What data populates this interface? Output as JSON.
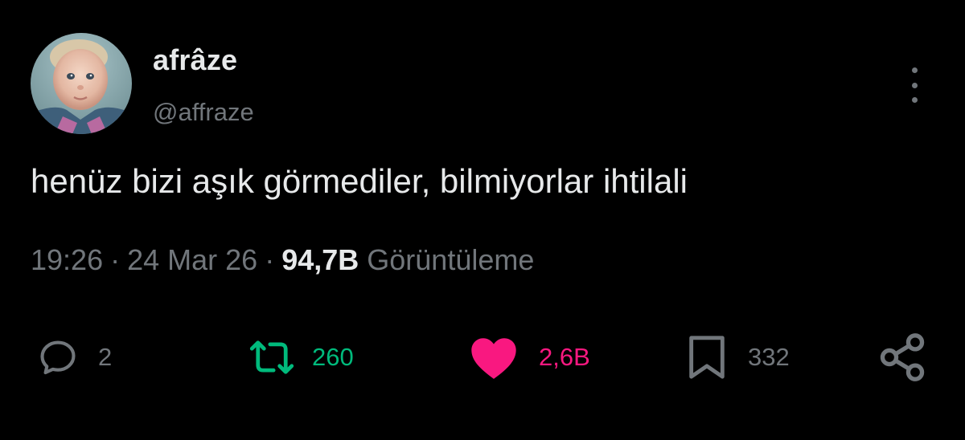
{
  "user": {
    "display_name": "afrâze",
    "handle": "@affraze"
  },
  "tweet": {
    "text": "henüz bizi aşık görmediler, bilmiyorlar ihtilali",
    "time": "19:26",
    "date": "24 Mar 26",
    "views_count": "94,7B",
    "views_label": "Görüntüleme",
    "separator": "·"
  },
  "actions": {
    "replies": "2",
    "retweets": "260",
    "likes": "2,6B",
    "bookmarks": "332"
  },
  "icons": {
    "more": "more-vertical-icon",
    "reply": "reply-icon",
    "retweet": "retweet-icon",
    "like": "heart-icon",
    "bookmark": "bookmark-icon",
    "share": "share-icon"
  },
  "colors": {
    "background": "#000000",
    "text": "#e7e9ea",
    "muted": "#71767b",
    "retweet": "#00ba7c",
    "like": "#f91880"
  }
}
